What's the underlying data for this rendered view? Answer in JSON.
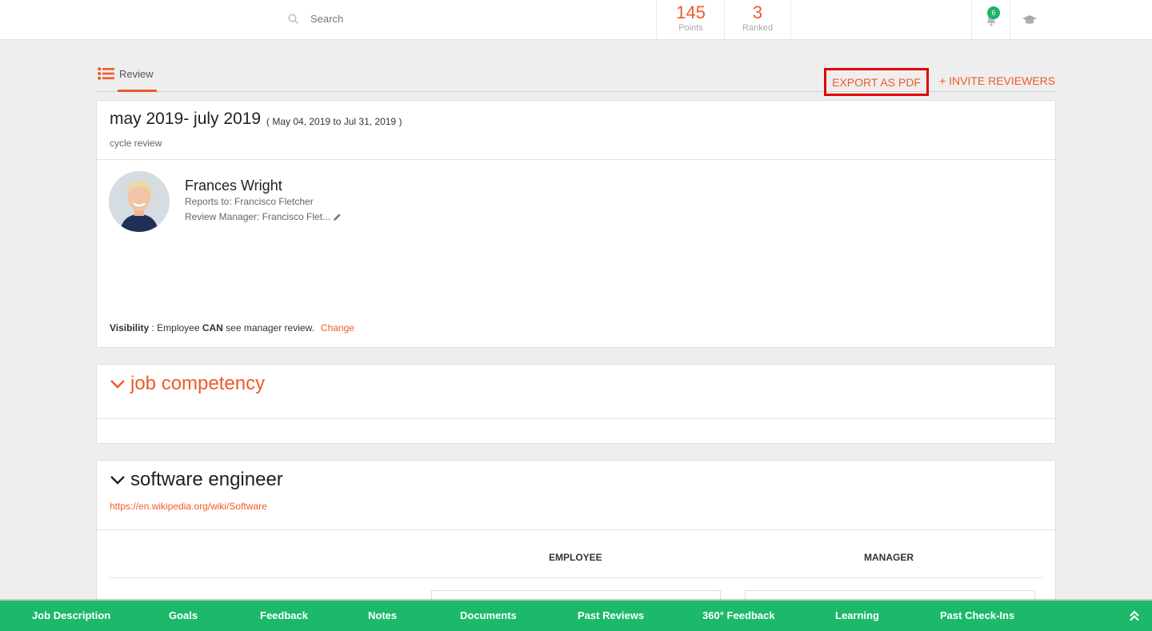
{
  "header": {
    "search_placeholder": "Search",
    "points_value": "145",
    "points_label": "Points",
    "ranked_value": "3",
    "ranked_label": "Ranked",
    "notification_count": "6",
    "icons": [
      "search-icon",
      "bell-icon",
      "graduation-cap-icon"
    ]
  },
  "tabs": {
    "review_label": "Review",
    "export_label": "EXPORT AS PDF",
    "invite_label": "+ INVITE REVIEWERS"
  },
  "review": {
    "title": "may 2019- july 2019",
    "range": "( May 04, 2019 to Jul 31, 2019 )",
    "subtitle": "cycle review",
    "employee": {
      "name": "Frances Wright",
      "reports_to": "Reports to: Francisco Fletcher",
      "review_manager": "Review Manager: Francisco Flet..."
    },
    "visibility": {
      "label": "Visibility",
      "sep": " : Employee ",
      "can": "CAN",
      "rest": " see manager review.",
      "change": "Change"
    }
  },
  "job_competency": {
    "title": "job competency"
  },
  "software_engineer": {
    "title": "software engineer",
    "link": "https://en.wikipedia.org/wiki/Software",
    "col_employee": "EMPLOYEE",
    "col_manager": "MANAGER"
  },
  "bottom_nav": {
    "items": [
      "Job Description",
      "Goals",
      "Feedback",
      "Notes",
      "Documents",
      "Past Reviews",
      "360° Feedback",
      "Learning",
      "Past Check-Ins"
    ]
  },
  "colors": {
    "accent": "#f05a28",
    "green": "#1cb96a",
    "highlight": "#e00000"
  }
}
